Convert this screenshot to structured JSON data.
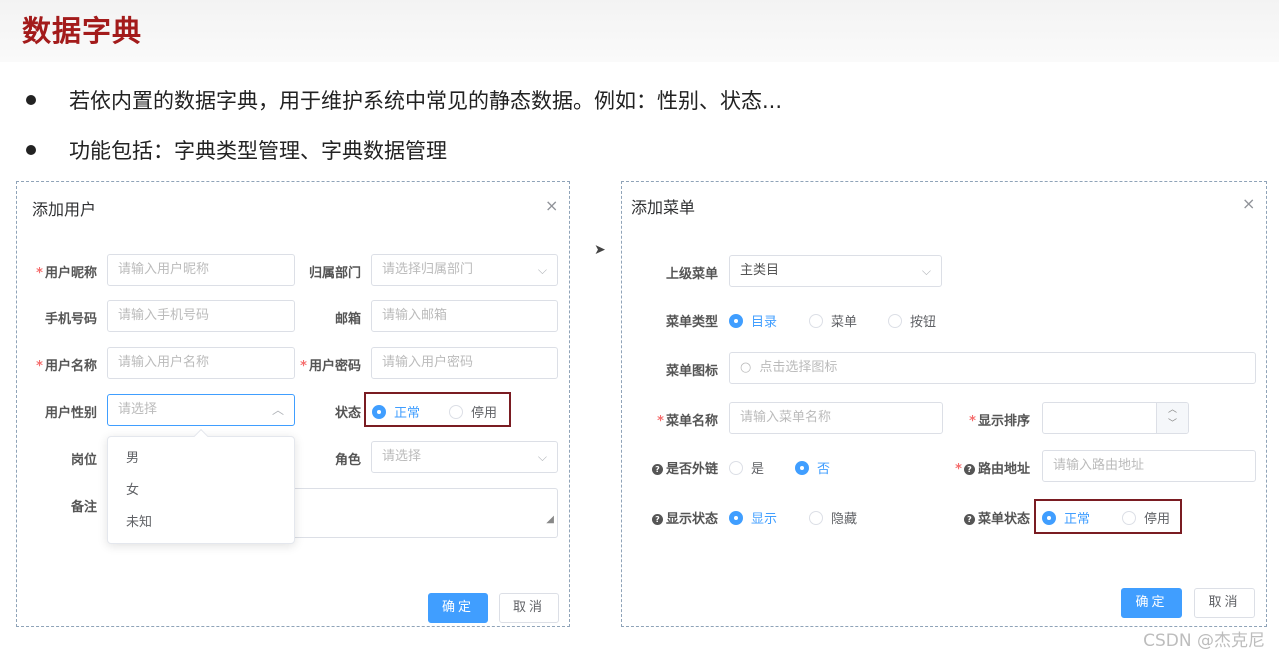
{
  "slide": {
    "title": "数据字典",
    "bullets": [
      "若依内置的数据字典，用于维护系统中常见的静态数据。例如：性别、状态...",
      "功能包括：字典类型管理、字典数据管理"
    ]
  },
  "user_dialog": {
    "title": "添加用户",
    "close": "×",
    "labels": {
      "nickname": "用户昵称",
      "dept": "归属部门",
      "phone": "手机号码",
      "email": "邮箱",
      "username": "用户名称",
      "password": "用户密码",
      "gender": "用户性别",
      "status": "状态",
      "post": "岗位",
      "role": "角色",
      "remark": "备注"
    },
    "placeholders": {
      "nickname": "请输入用户昵称",
      "dept": "请选择归属部门",
      "phone": "请输入手机号码",
      "email": "请输入邮箱",
      "username": "请输入用户名称",
      "password": "请输入用户密码",
      "gender": "请选择",
      "role": "请选择"
    },
    "status_options": [
      "正常",
      "停用"
    ],
    "gender_options": [
      "男",
      "女",
      "未知"
    ],
    "confirm": "确定",
    "cancel": "取消"
  },
  "menu_dialog": {
    "title": "添加菜单",
    "close": "×",
    "labels": {
      "parent": "上级菜单",
      "type": "菜单类型",
      "icon": "菜单图标",
      "name": "菜单名称",
      "order": "显示排序",
      "external": "是否外链",
      "route": "路由地址",
      "visible": "显示状态",
      "status": "菜单状态"
    },
    "parent_value": "主类目",
    "type_options": [
      "目录",
      "菜单",
      "按钮"
    ],
    "icon_placeholder": "点击选择图标",
    "name_placeholder": "请输入菜单名称",
    "route_placeholder": "请输入路由地址",
    "external_options": [
      "是",
      "否"
    ],
    "visible_options": [
      "显示",
      "隐藏"
    ],
    "status_options": [
      "正常",
      "停用"
    ],
    "confirm": "确定",
    "cancel": "取消"
  },
  "watermark": "CSDN @杰克尼"
}
